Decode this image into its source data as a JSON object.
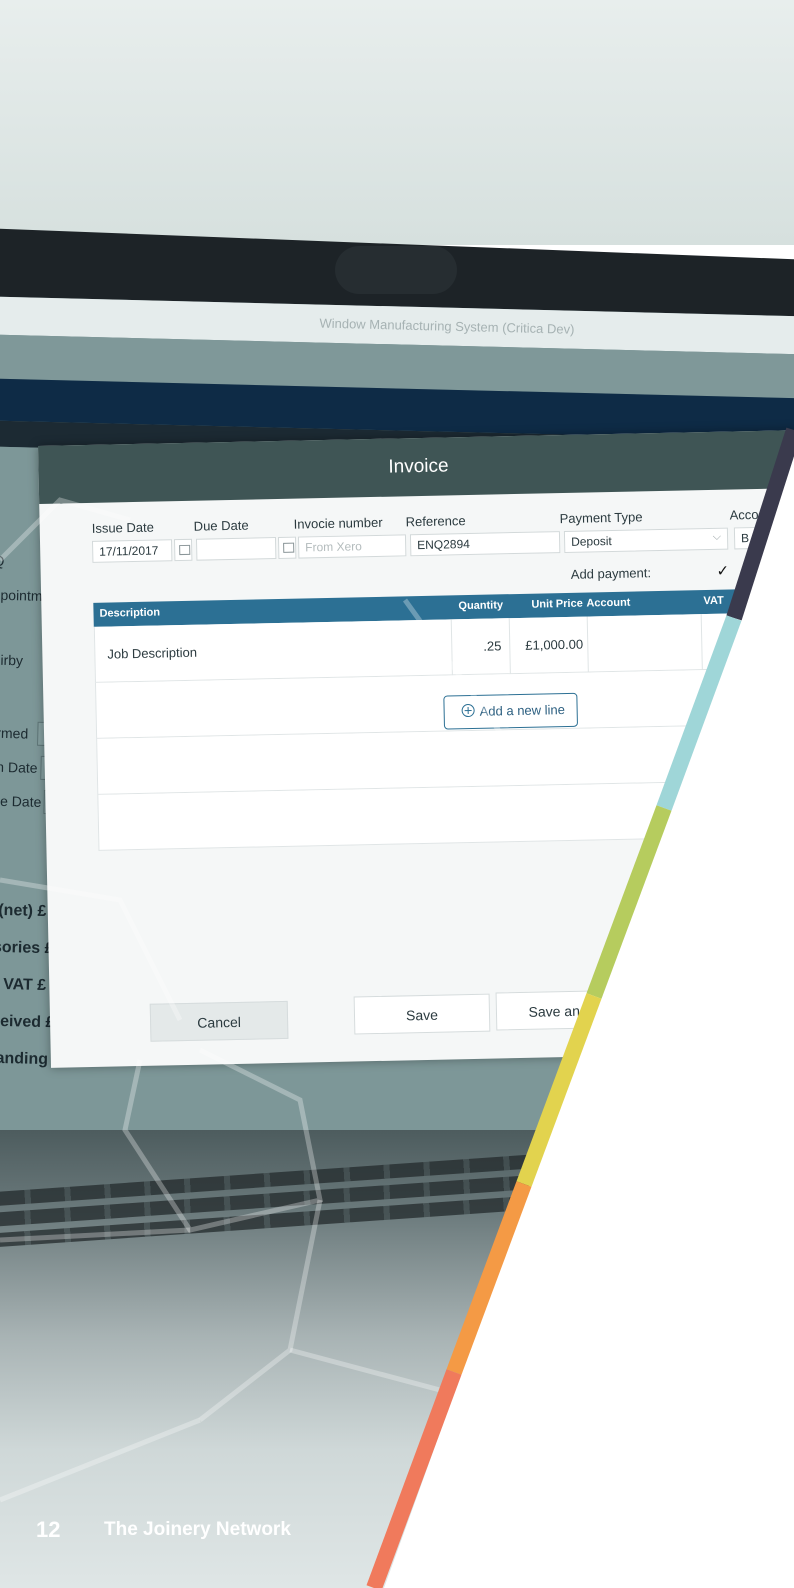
{
  "window": {
    "title": "Window Manufacturing System (Critica Dev)"
  },
  "side_form": {
    "labels": [
      "Q",
      "ppointment",
      "Kirby",
      "firmed",
      "on Date",
      "ure Date"
    ],
    "money_labels": [
      "e (net) £",
      "ssories £",
      "VAT £",
      "eceived £",
      "standing £"
    ]
  },
  "dialog": {
    "title": "Invoice",
    "fields": {
      "issue_date": {
        "label": "Issue Date",
        "value": "17/11/2017"
      },
      "due_date": {
        "label": "Due Date",
        "value": ""
      },
      "invoice_number": {
        "label": "Invocie number",
        "placeholder": "From Xero"
      },
      "reference": {
        "label": "Reference",
        "value": "ENQ2894"
      },
      "payment_type": {
        "label": "Payment Type",
        "value": "Deposit"
      },
      "account": {
        "label": "Acco",
        "value": "B"
      },
      "add_payment": {
        "label": "Add payment:",
        "checked_mark": "✓"
      }
    },
    "table": {
      "columns": [
        "Description",
        "Quantity",
        "Unit Price",
        "Account",
        "VAT"
      ],
      "rows": [
        {
          "description": "Job Description",
          "quantity": ".25",
          "unit_price": "£1,000.00",
          "account": "",
          "vat": ""
        }
      ]
    },
    "add_line_label": "Add a new line",
    "buttons": {
      "cancel": "Cancel",
      "save": "Save",
      "save_and_print": "Save and Pre"
    }
  },
  "footer": {
    "page_number": "12",
    "brand": "The Joinery Network"
  },
  "colors": {
    "stripes": [
      "#3a3a4d",
      "#9fd6d8",
      "#b6cc5e",
      "#e2d34e",
      "#f49a45",
      "#f07a5c"
    ],
    "table_header": "#2c7094",
    "dialog_header": "#3f5555"
  }
}
